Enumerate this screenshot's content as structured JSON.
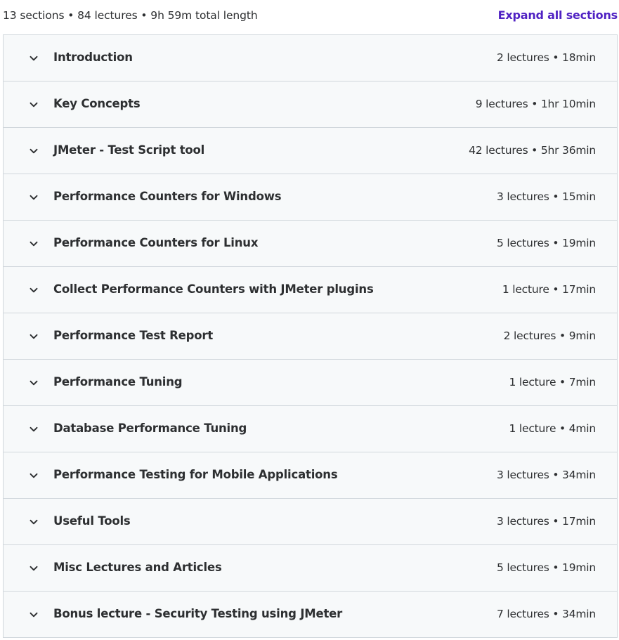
{
  "summary": {
    "text": "13 sections • 84 lectures • 9h 59m total length",
    "expand_label": "Expand all sections"
  },
  "sections": [
    {
      "title": "Introduction",
      "meta": "2 lectures • 18min"
    },
    {
      "title": "Key Concepts",
      "meta": "9 lectures • 1hr 10min"
    },
    {
      "title": "JMeter - Test Script tool",
      "meta": "42 lectures • 5hr 36min"
    },
    {
      "title": "Performance Counters for Windows",
      "meta": "3 lectures • 15min"
    },
    {
      "title": "Performance Counters for Linux",
      "meta": "5 lectures • 19min"
    },
    {
      "title": "Collect Performance Counters with JMeter plugins",
      "meta": "1 lecture • 17min"
    },
    {
      "title": "Performance Test Report",
      "meta": "2 lectures • 9min"
    },
    {
      "title": "Performance Tuning",
      "meta": "1 lecture • 7min"
    },
    {
      "title": "Database Performance Tuning",
      "meta": "1 lecture • 4min"
    },
    {
      "title": "Performance Testing for Mobile Applications",
      "meta": "3 lectures • 34min"
    },
    {
      "title": "Useful Tools",
      "meta": "3 lectures • 17min"
    },
    {
      "title": "Misc Lectures and Articles",
      "meta": "5 lectures • 19min"
    },
    {
      "title": "Bonus lecture - Security Testing using JMeter",
      "meta": "7 lectures • 34min"
    }
  ],
  "colors": {
    "accent": "#5022c3",
    "text": "#2d2f31",
    "row_background": "#f7f9fa",
    "border": "#d1d7dc"
  },
  "icons": {
    "row_toggle": "chevron-down-icon"
  }
}
